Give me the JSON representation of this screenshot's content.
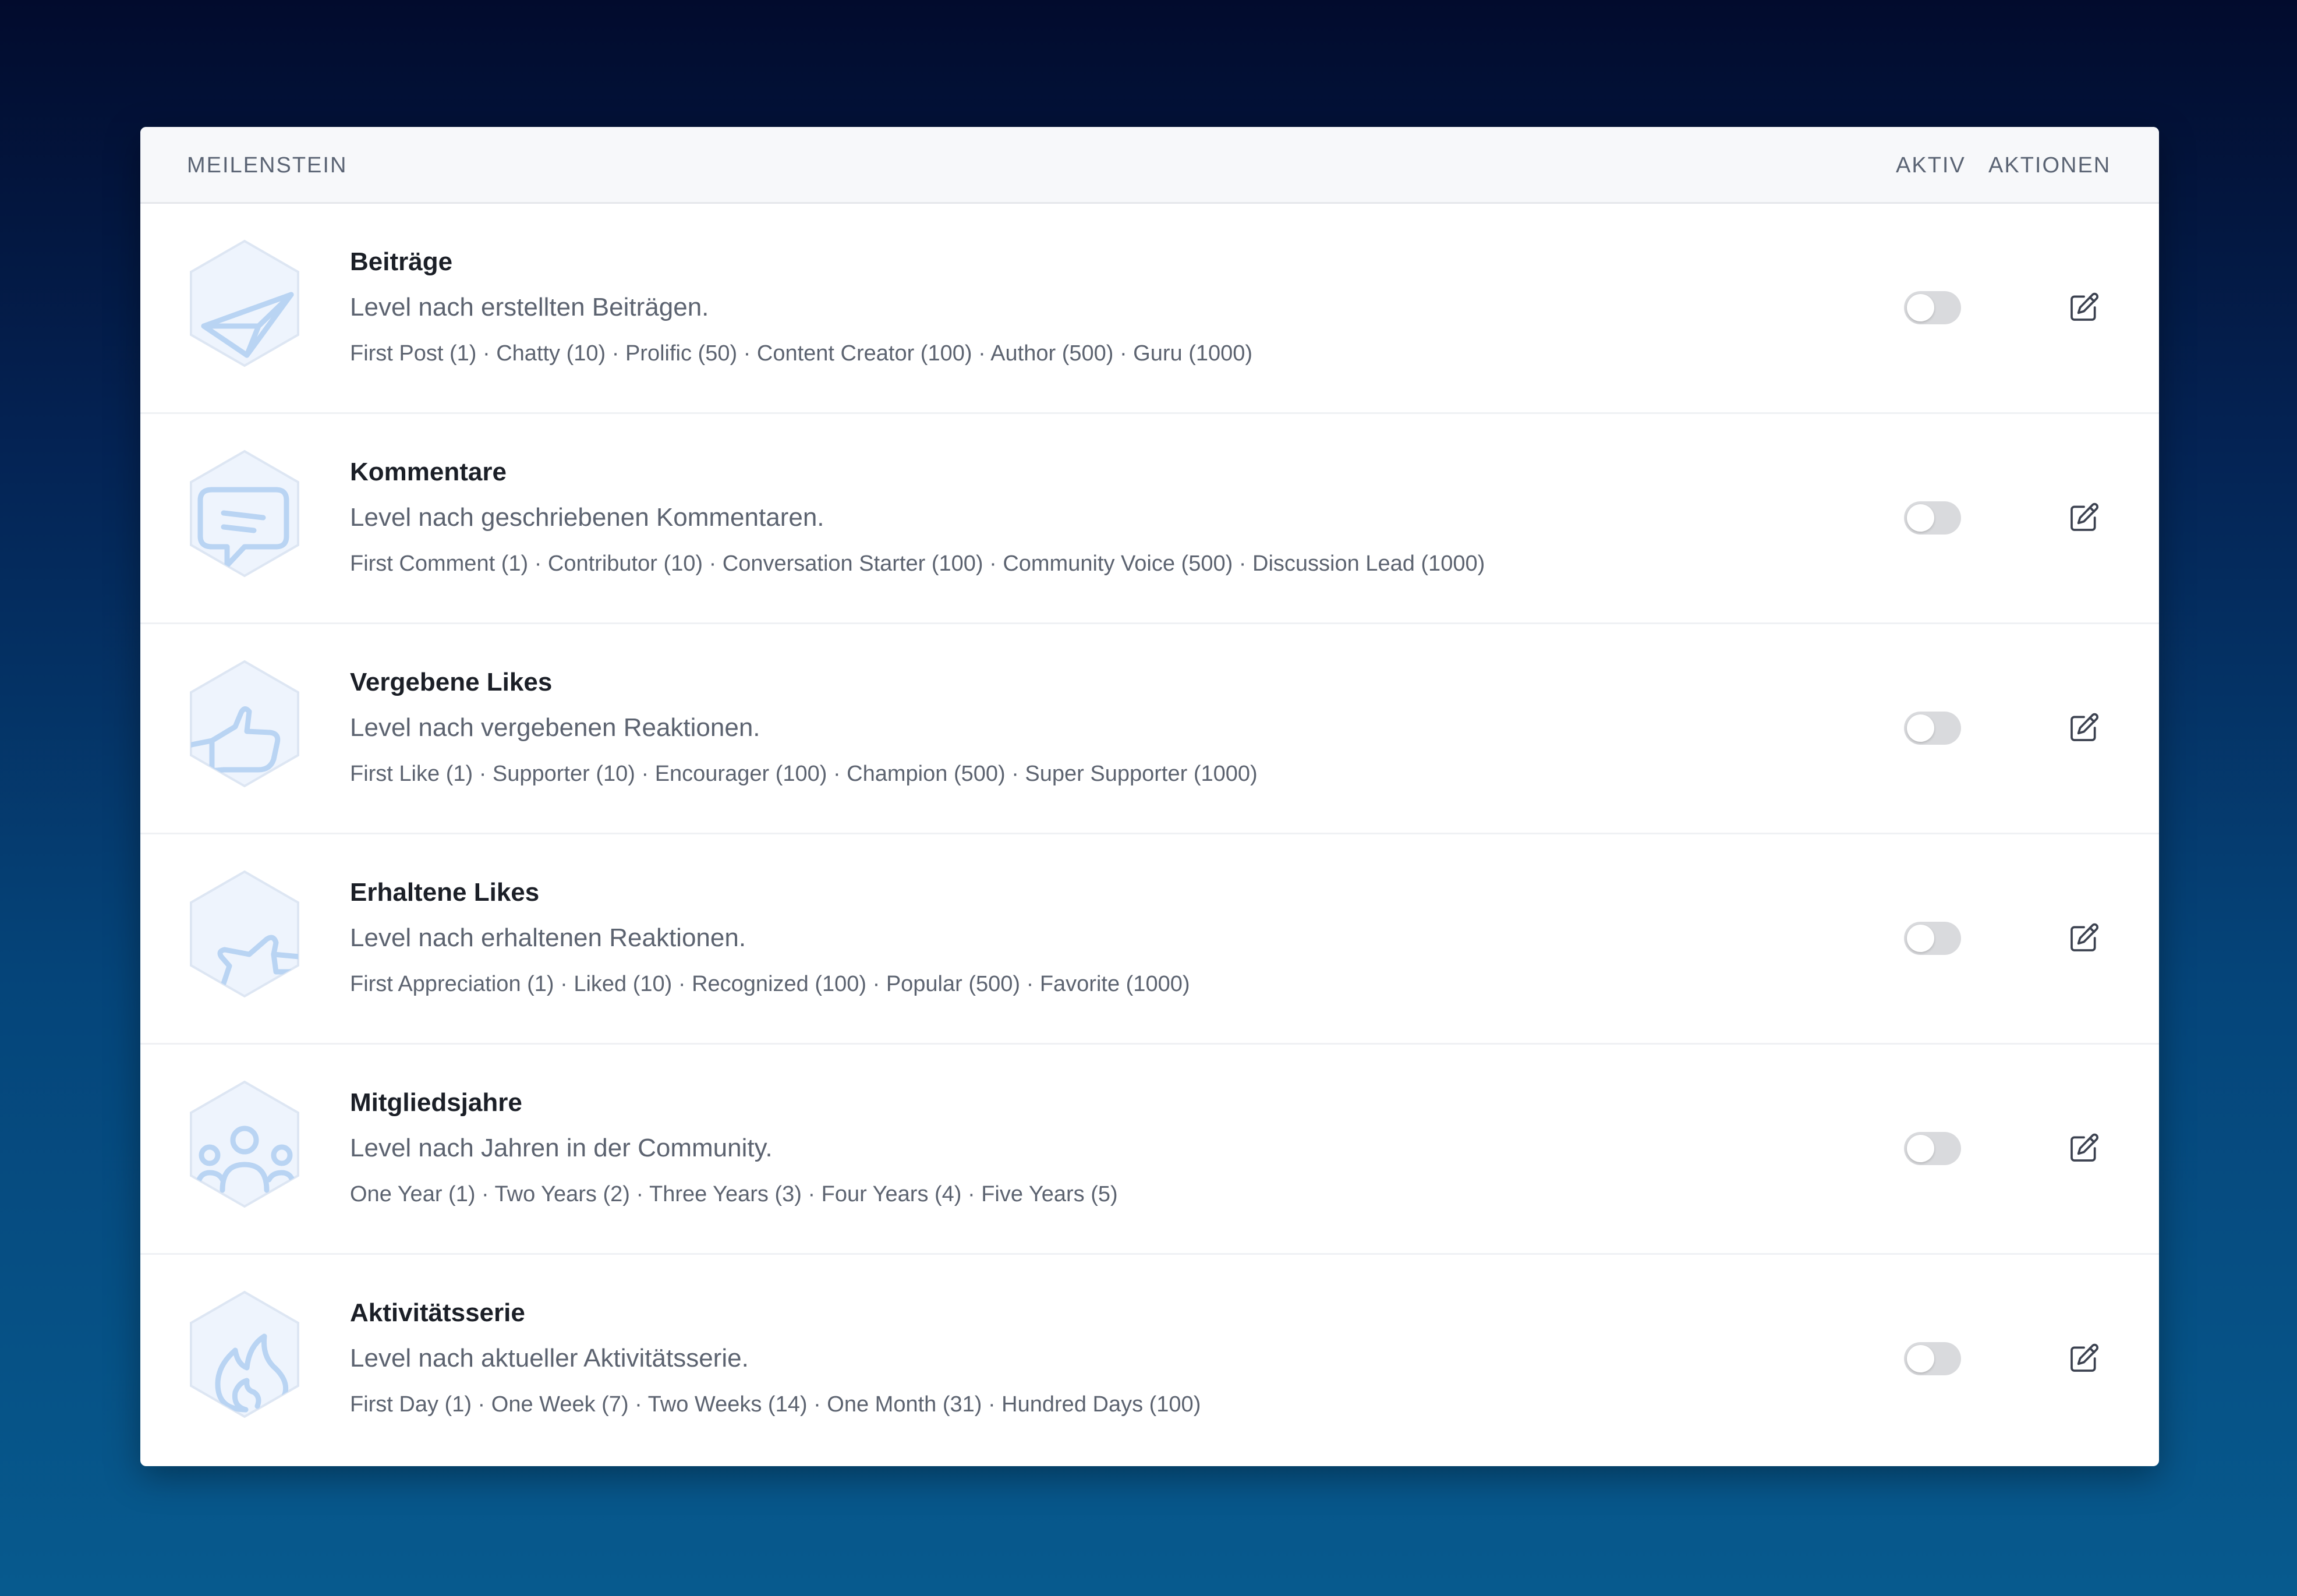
{
  "table": {
    "headers": {
      "milestone": "MEILENSTEIN",
      "active": "AKTIV",
      "actions": "AKTIONEN"
    },
    "rows": [
      {
        "title": "Beiträge",
        "description": "Level nach erstellten Beiträgen.",
        "levels": "First Post (1) · Chatty (10) · Prolific (50) · Content Creator (100) · Author (500) · Guru (1000)",
        "icon": "paper-plane-icon",
        "active": false
      },
      {
        "title": "Kommentare",
        "description": "Level nach geschriebenen Kommentaren.",
        "levels": "First Comment (1) · Contributor (10) · Conversation Starter (100) · Community Voice (500) · Discussion Lead (1000)",
        "icon": "comment-icon",
        "active": false
      },
      {
        "title": "Vergebene Likes",
        "description": "Level nach vergebenen Reaktionen.",
        "levels": "First Like (1) · Supporter (10) · Encourager (100) · Champion (500) · Super Supporter (1000)",
        "icon": "thumbs-up-icon",
        "active": false
      },
      {
        "title": "Erhaltene Likes",
        "description": "Level nach erhaltenen Reaktionen.",
        "levels": "First Appreciation (1) · Liked (10) · Recognized (100) · Popular (500) · Favorite (1000)",
        "icon": "thumbs-up-icon",
        "active": false
      },
      {
        "title": "Mitgliedsjahre",
        "description": "Level nach Jahren in der Community.",
        "levels": "One Year (1) · Two Years (2) · Three Years (3) · Four Years (4) · Five Years (5)",
        "icon": "users-icon",
        "active": false
      },
      {
        "title": "Aktivitätsserie",
        "description": "Level nach aktueller Aktivitätsserie.",
        "levels": "First Day (1) · One Week (7) · Two Weeks (14) · One Month (31) · Hundred Days (100)",
        "icon": "flame-icon",
        "active": false
      }
    ]
  },
  "colors": {
    "badge_fill": "#eef4fd",
    "badge_stroke": "#dde6f3",
    "badge_icon": "#b9d4f3",
    "toggle_off": "#d9dadd"
  }
}
